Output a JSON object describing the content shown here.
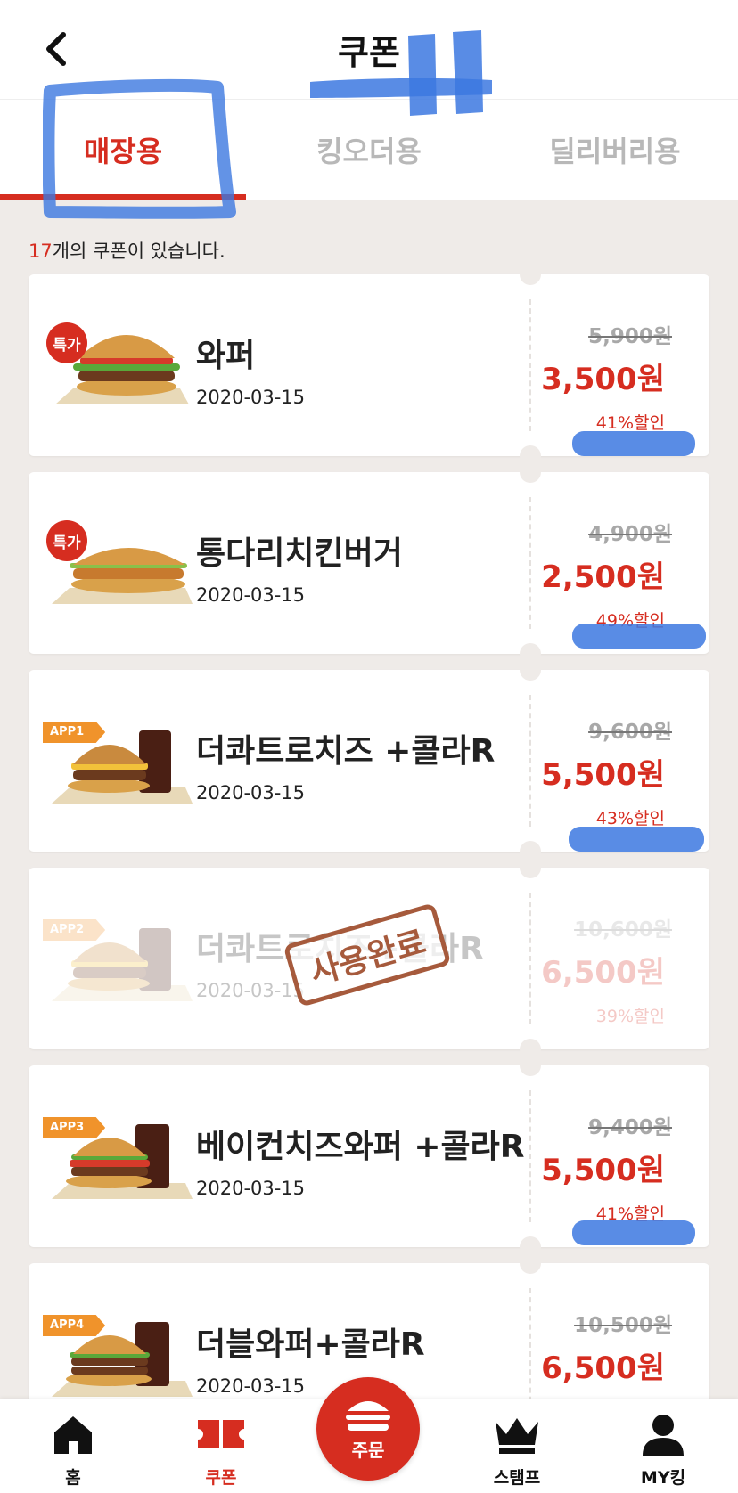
{
  "header": {
    "title": "쿠폰",
    "back_label": "뒤로"
  },
  "tabs": [
    {
      "label": "매장용",
      "active": true
    },
    {
      "label": "킹오더용",
      "active": false
    },
    {
      "label": "딜리버리용",
      "active": false
    }
  ],
  "count": {
    "number": "17",
    "suffix": "개의 쿠폰이 있습니다."
  },
  "coupons": [
    {
      "badge": "특가",
      "badge_type": "round",
      "name": "와퍼",
      "date": "2020-03-15",
      "original_price": "5,900원",
      "price": "3,500원",
      "discount": "41%할인",
      "used": false
    },
    {
      "badge": "특가",
      "badge_type": "round",
      "name": "통다리치킨버거",
      "date": "2020-03-15",
      "original_price": "4,900원",
      "price": "2,500원",
      "discount": "49%할인",
      "used": false
    },
    {
      "badge": "APP1",
      "badge_type": "tag",
      "name": "더콰트로치즈 +콜라R",
      "date": "2020-03-15",
      "original_price": "9,600원",
      "price": "5,500원",
      "discount": "43%할인",
      "used": false
    },
    {
      "badge": "APP2",
      "badge_type": "tag",
      "name": "더콰트로치즈+콜라R",
      "date": "2020-03-15",
      "original_price": "10,600원",
      "price": "6,500원",
      "discount": "39%할인",
      "used": true,
      "stamp": "사용완료"
    },
    {
      "badge": "APP3",
      "badge_type": "tag",
      "name": "베이컨치즈와퍼 +콜라R",
      "date": "2020-03-15",
      "original_price": "9,400원",
      "price": "5,500원",
      "discount": "41%할인",
      "used": false
    },
    {
      "badge": "APP4",
      "badge_type": "tag",
      "name": "더블와퍼+콜라R",
      "date": "2020-03-15",
      "original_price": "10,500원",
      "price": "6,500원",
      "discount": "",
      "used": false
    }
  ],
  "nav": {
    "home": "홈",
    "coupon": "쿠폰",
    "order": "주문",
    "stamp": "스탬프",
    "myking": "MY킹"
  },
  "colors": {
    "brand_red": "#d62d20",
    "tag_orange": "#f0932b",
    "background": "#efebe8",
    "scribble_blue": "#3c78e0"
  }
}
